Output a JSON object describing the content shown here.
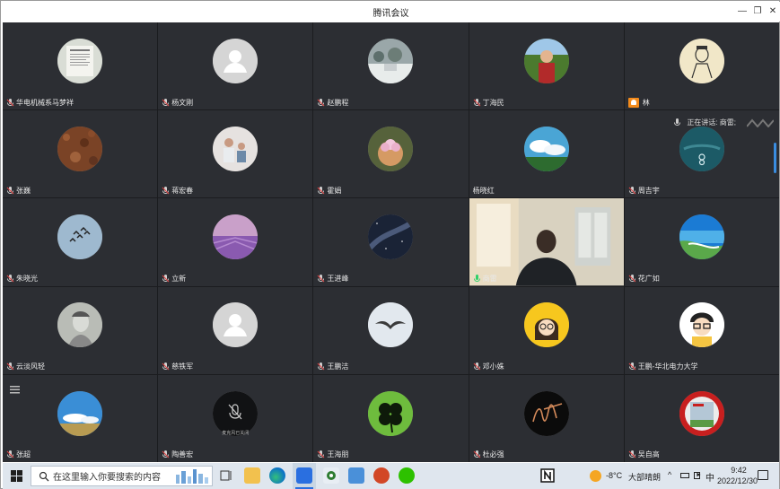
{
  "window": {
    "title": "腾讯会议"
  },
  "participants": [
    {
      "name": "华电机械系马梦祥",
      "kind": "photo-doc"
    },
    {
      "name": "杨文刚",
      "kind": "default"
    },
    {
      "name": "赵鹏程",
      "kind": "snow"
    },
    {
      "name": "丁海民",
      "kind": "child"
    },
    {
      "name": "林",
      "kind": "sketch",
      "host": true
    },
    {
      "name": "张巍",
      "kind": "soil"
    },
    {
      "name": "蒋宏春",
      "kind": "family"
    },
    {
      "name": "霍娟",
      "kind": "flower"
    },
    {
      "name": "杨晓红",
      "kind": "clouds",
      "no_mic": true
    },
    {
      "name": "周吉宇",
      "kind": "teal",
      "speaking_label": "正在讲话: 商雷;"
    },
    {
      "name": "朱晓光",
      "kind": "jets"
    },
    {
      "name": "立新",
      "kind": "lavender"
    },
    {
      "name": "王进峰",
      "kind": "night"
    },
    {
      "name": "商雷",
      "kind": "video",
      "active_mic": true
    },
    {
      "name": "花广如",
      "kind": "coast"
    },
    {
      "name": "云淡风轻",
      "kind": "portrait"
    },
    {
      "name": "慈铁军",
      "kind": "default"
    },
    {
      "name": "王鹏洁",
      "kind": "bird"
    },
    {
      "name": "邓小姝",
      "kind": "cartoon-girl"
    },
    {
      "name": "王鹏-华北电力大学",
      "kind": "cartoon-boy"
    },
    {
      "name": "张超",
      "kind": "sky",
      "menu_icon": true
    },
    {
      "name": "陶善宏",
      "kind": "mic-off",
      "mic_off_label": "麦克风已关闭"
    },
    {
      "name": "王海朋",
      "kind": "clover"
    },
    {
      "name": "杜必强",
      "kind": "signature"
    },
    {
      "name": "吴自高",
      "kind": "redframe"
    }
  ],
  "taskbar": {
    "search_placeholder": "在这里输入你要搜索的内容",
    "weather_temp": "-8°C",
    "weather_text": "大部晴朗",
    "ime": "中",
    "time": "9:42",
    "date": "2022/12/30"
  }
}
